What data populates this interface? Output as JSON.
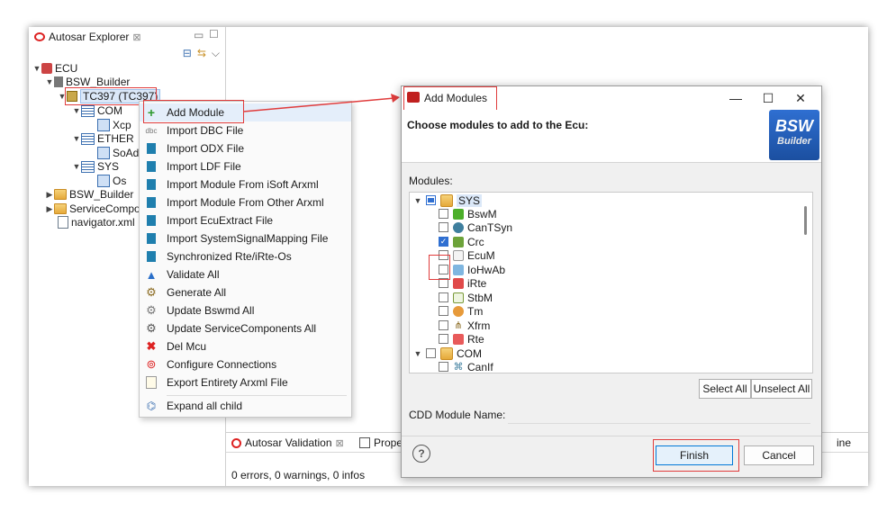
{
  "explorer": {
    "tab_label": "Autosar Explorer",
    "tree": [
      {
        "label": "ECU"
      },
      {
        "label": "BSW_Builder"
      },
      {
        "label": "TC397 (TC397)"
      },
      {
        "label": "COM"
      },
      {
        "label": "Xcp"
      },
      {
        "label": "ETHER"
      },
      {
        "label": "SoAd"
      },
      {
        "label": "SYS"
      },
      {
        "label": "Os"
      },
      {
        "label": "BSW_Builder"
      },
      {
        "label": "ServiceCompo"
      },
      {
        "label": "navigator.xml"
      }
    ]
  },
  "context_menu": {
    "items": [
      {
        "label": "Add Module",
        "icon": "plus-icon"
      },
      {
        "label": "Import DBC File",
        "icon": "dbc-icon"
      },
      {
        "label": "Import ODX File",
        "icon": "file-icon"
      },
      {
        "label": "Import LDF File",
        "icon": "file-icon"
      },
      {
        "label": "Import Module From iSoft Arxml",
        "icon": "file-icon"
      },
      {
        "label": "Import Module From Other Arxml",
        "icon": "file-icon"
      },
      {
        "label": "Import EcuExtract File",
        "icon": "file-icon"
      },
      {
        "label": "Import SystemSignalMapping File",
        "icon": "file-icon"
      },
      {
        "label": "Synchronized Rte/iRte-Os",
        "icon": "file-icon"
      },
      {
        "label": "Validate All",
        "icon": "warning-icon"
      },
      {
        "label": "Generate All",
        "icon": "gears-icon"
      },
      {
        "label": "Update Bswmd All",
        "icon": "update-icon"
      },
      {
        "label": "Update ServiceComponents All",
        "icon": "update-icon"
      },
      {
        "label": "Del Mcu",
        "icon": "delete-icon"
      },
      {
        "label": "Configure Connections",
        "icon": "connection-icon"
      },
      {
        "label": "Export Entirety Arxml File",
        "icon": "export-icon"
      },
      {
        "label": "Expand all child",
        "icon": "expand-icon"
      }
    ]
  },
  "dialog": {
    "title": "Add Modules",
    "heading": "Choose modules to add to the Ecu:",
    "logo_line1": "BSW",
    "logo_line2": "Builder",
    "modules_label": "Modules:",
    "modules": [
      {
        "label": "SYS",
        "state": "partial"
      },
      {
        "label": "BswM",
        "state": "unchecked"
      },
      {
        "label": "CanTSyn",
        "state": "unchecked"
      },
      {
        "label": "Crc",
        "state": "checked"
      },
      {
        "label": "EcuM",
        "state": "unchecked"
      },
      {
        "label": "IoHwAb",
        "state": "unchecked"
      },
      {
        "label": "iRte",
        "state": "unchecked"
      },
      {
        "label": "StbM",
        "state": "unchecked"
      },
      {
        "label": "Tm",
        "state": "unchecked"
      },
      {
        "label": "Xfrm",
        "state": "unchecked"
      },
      {
        "label": "Rte",
        "state": "unchecked"
      },
      {
        "label": "COM",
        "state": "unchecked"
      },
      {
        "label": "CanIf",
        "state": "unchecked"
      }
    ],
    "select_all": "Select All",
    "unselect_all": "Unselect All",
    "cdd_label": "CDD Module Name:",
    "cdd_value": "",
    "finish": "Finish",
    "cancel": "Cancel",
    "help": "?"
  },
  "bottom": {
    "tab_validation": "Autosar Validation",
    "tab_properties": "Prope",
    "tab_right": "ine",
    "status": "0 errors, 0 warnings, 0 infos"
  },
  "colors": {
    "accent": "#2f6fd1",
    "highlight_box": "#e03c3c"
  }
}
